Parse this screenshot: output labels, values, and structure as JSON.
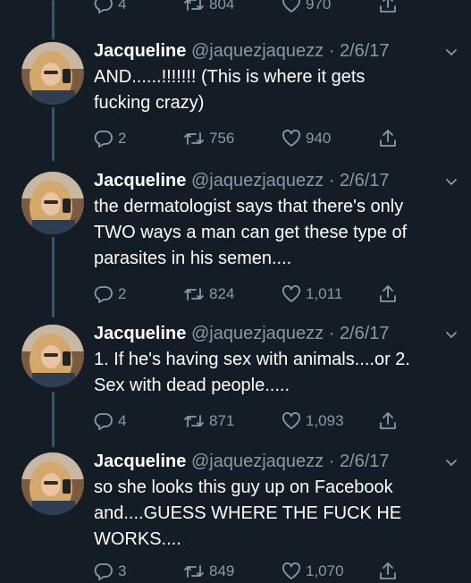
{
  "colors": {
    "background": "#141d26",
    "text_primary": "#ffffff",
    "text_secondary": "#8899a6",
    "thread_line": "#3d5466"
  },
  "top_actions": {
    "replies": "4",
    "retweets": "804",
    "likes": "970"
  },
  "tweets": [
    {
      "name": "Jacqueline",
      "handle": "@jaquezjaquezz",
      "separator": "·",
      "date": "2/6/17",
      "lines": [
        "AND......!!!!!!! (This is where it gets",
        "fucking crazy)"
      ],
      "replies": "2",
      "retweets": "756",
      "likes": "940"
    },
    {
      "name": "Jacqueline",
      "handle": "@jaquezjaquezz",
      "separator": "·",
      "date": "2/6/17",
      "lines": [
        "the dermatologist says that there's only",
        "TWO ways a man can get these type of",
        "parasites in his semen...."
      ],
      "replies": "2",
      "retweets": "824",
      "likes": "1,011"
    },
    {
      "name": "Jacqueline",
      "handle": "@jaquezjaquezz",
      "separator": "·",
      "date": "2/6/17",
      "lines": [
        "1. If he's having sex with animals....or 2.",
        "Sex with dead people....."
      ],
      "replies": "4",
      "retweets": "871",
      "likes": "1,093"
    },
    {
      "name": "Jacqueline",
      "handle": "@jaquezjaquezz",
      "separator": "·",
      "date": "2/6/17",
      "lines": [
        "so she looks this guy up on Facebook",
        "and....GUESS WHERE THE FUCK HE",
        "WORKS...."
      ],
      "replies": "3",
      "retweets": "849",
      "likes": "1,070"
    }
  ]
}
